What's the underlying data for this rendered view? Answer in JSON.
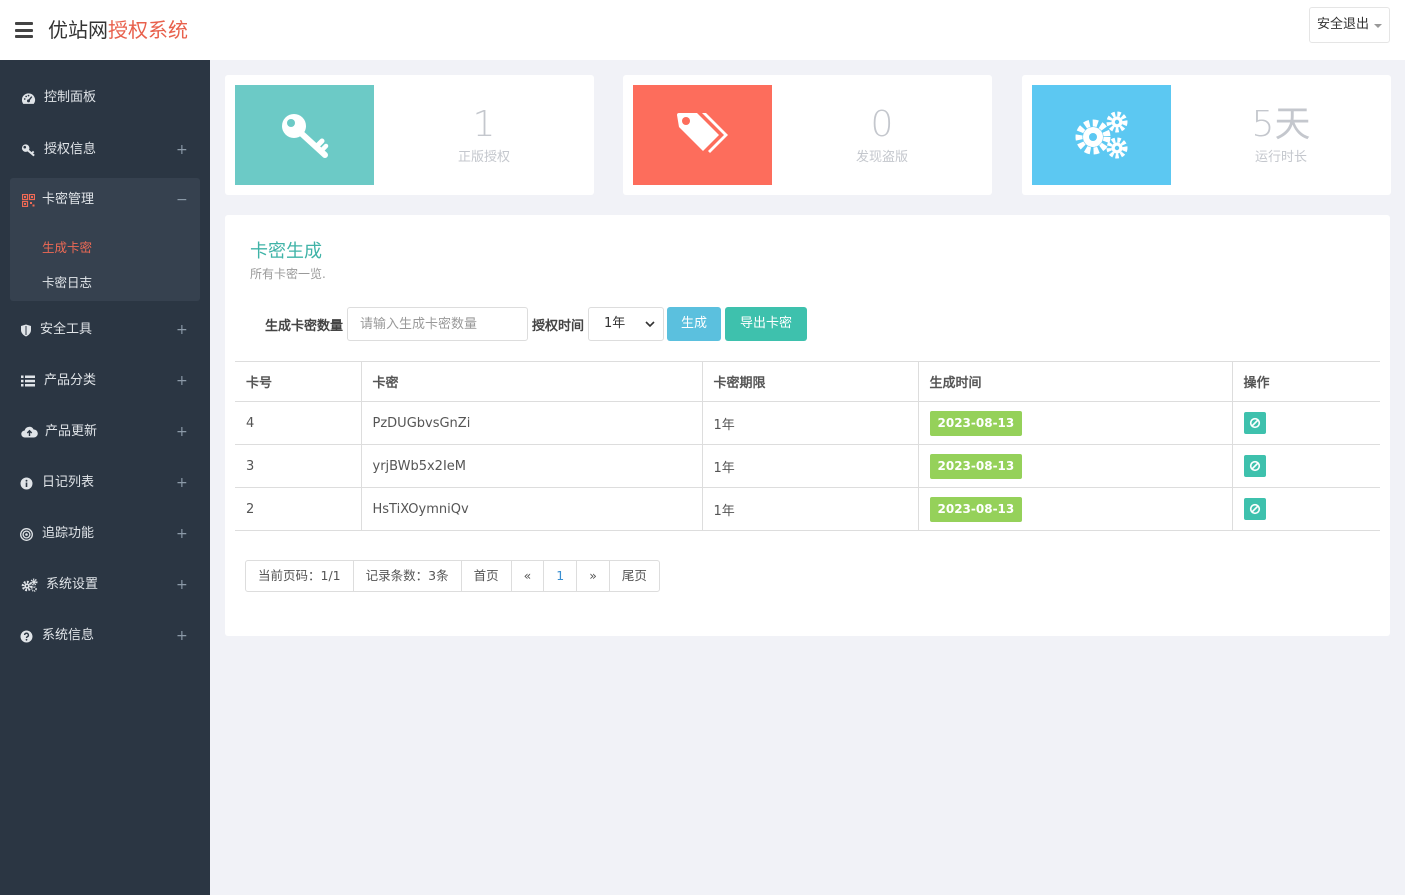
{
  "header": {
    "brand_part1": "优站网",
    "brand_part2": "授权系统",
    "logout_label": "安全退出"
  },
  "sidebar": {
    "items": [
      {
        "label": "控制面板",
        "icon": "dashboard-icon",
        "toggle": ""
      },
      {
        "label": "授权信息",
        "icon": "key-icon",
        "toggle": "+"
      },
      {
        "label": "卡密管理",
        "icon": "qrcode-icon",
        "toggle": "−"
      },
      {
        "label": "安全工具",
        "icon": "shield-icon",
        "toggle": "+"
      },
      {
        "label": "产品分类",
        "icon": "list-icon",
        "toggle": "+"
      },
      {
        "label": "产品更新",
        "icon": "cloud-upload-icon",
        "toggle": "+"
      },
      {
        "label": "日记列表",
        "icon": "info-icon",
        "toggle": "+"
      },
      {
        "label": "追踪功能",
        "icon": "target-icon",
        "toggle": "+"
      },
      {
        "label": "系统设置",
        "icon": "cogs-icon",
        "toggle": "+"
      },
      {
        "label": "系统信息",
        "icon": "question-icon",
        "toggle": "+"
      }
    ],
    "sub_items": [
      {
        "label": "生成卡密",
        "active": true
      },
      {
        "label": "卡密日志",
        "active": false
      }
    ]
  },
  "stats": [
    {
      "value": "1",
      "caption": "正版授权",
      "icon": "key-icon",
      "color": "#6ccac6"
    },
    {
      "value": "0",
      "caption": "发现盗版",
      "icon": "tags-icon",
      "color": "#fd6d5c"
    },
    {
      "value": "5天",
      "caption": "运行时长",
      "icon": "cogs-icon",
      "color": "#5cc8f2"
    }
  ],
  "panel": {
    "title": "卡密生成",
    "subtitle": "所有卡密一览.",
    "qty_label": "生成卡密数量",
    "qty_placeholder": "请输入生成卡密数量",
    "period_label": "授权时间",
    "period_value": "1年",
    "generate_label": "生成",
    "export_label": "导出卡密"
  },
  "table": {
    "columns": [
      "卡号",
      "卡密",
      "卡密期限",
      "生成时间",
      "操作"
    ],
    "rows": [
      {
        "id": "4",
        "key": "PzDUGbvsGnZi",
        "period": "1年",
        "date": "2023-08-13"
      },
      {
        "id": "3",
        "key": "yrjBWb5x2IeM",
        "period": "1年",
        "date": "2023-08-13"
      },
      {
        "id": "2",
        "key": "HsTiXOymniQv",
        "period": "1年",
        "date": "2023-08-13"
      }
    ]
  },
  "pagination": {
    "current_page": "当前页码：1/1",
    "record_count": "记录条数：3条",
    "first": "首页",
    "prev": "«",
    "page": "1",
    "next": "»",
    "last": "尾页"
  },
  "colors": {
    "sidebar_bg": "#2b3643",
    "accent_teal": "#3ec1ad",
    "accent_red": "#e8604c",
    "badge_green": "#95d15a"
  }
}
